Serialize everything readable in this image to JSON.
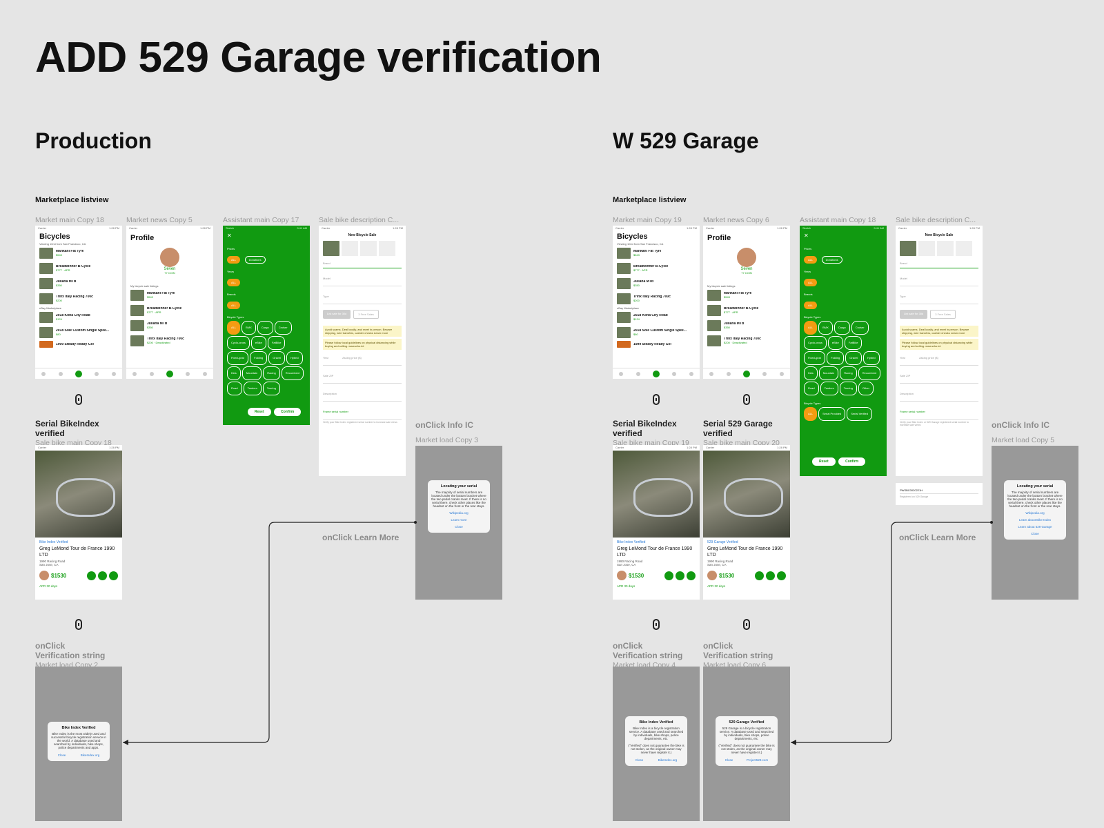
{
  "title": "ADD 529 Garage verification",
  "columns": {
    "production": "Production",
    "garage": "W 529 Garage"
  },
  "section_label": "Marketplace listview",
  "frame_labels": {
    "p_main": "Market main Copy 18",
    "p_news": "Market news Copy 5",
    "p_assist": "Assistant main Copy 17",
    "p_sale": "Sale bike description C...",
    "g_main": "Market main Copy 19",
    "g_news": "Market news Copy 6",
    "g_assist": "Assistant main Copy 18",
    "g_sale": "Sale bike description C..."
  },
  "annotations": {
    "serial_bikeindex": "Serial BikeIndex verified",
    "serial_529": "Serial 529 Garage verified",
    "p_sale_main": "Sale bike main Copy 18",
    "g_sale_main1": "Sale bike main Copy 19",
    "g_sale_main2": "Sale bike main Copy 20",
    "onclick_info": "onClick Info IC",
    "p_load3": "Market load Copy 3",
    "g_load5": "Market load Copy 5",
    "onclick_learn": "onClick Learn More",
    "onclick": "onClick",
    "verification_string": "Verification string",
    "p_load2": "Market load Copy 2",
    "g_load4": "Market load Copy 4",
    "g_load6": "Market load Copy 6"
  },
  "market": {
    "title": "Bicycles",
    "chips": "Viewing 10mi from San Francisco, CA",
    "items": [
      {
        "name": "Mankani Fat Tyre",
        "price": "$543"
      },
      {
        "name": "Breadwinner B-Cycle",
        "price": "$777 · APR"
      },
      {
        "name": "Juliana MTB",
        "price": "$350"
      },
      {
        "name": "Trinx Italy Racing 700c",
        "price": "$200"
      },
      {
        "name": "2018 Kona City Road",
        "price": "$124"
      },
      {
        "name": "2018 Solé Custom Single Spee...",
        "price": "$80"
      },
      {
        "name": "1999 Steady Ready Go!",
        "price": ""
      }
    ],
    "ebay": "eBay Marketplace"
  },
  "profile": {
    "title": "Profile",
    "name": "Seven",
    "coins": "77 COIN",
    "listings_label": "My bicycle sale listings",
    "items": [
      {
        "name": "Mankani Fat Tyre",
        "price": "$543"
      },
      {
        "name": "Breadwinner B-Cycle",
        "price": "$777 · APR"
      },
      {
        "name": "Juliana MTB",
        "price": "$350"
      },
      {
        "name": "Trinx Italy Racing 700c",
        "price": "$200 · Deactivated"
      }
    ]
  },
  "assistant": {
    "prices": "Prices",
    "years": "Years",
    "brands": "Brands",
    "types": "Bicycle Types",
    "all": "ALL",
    "donations": "Donations",
    "type_chips": [
      "BMX",
      "Cargo",
      "Cruiser",
      "Cyclo-cross",
      "eBike",
      "FatBike",
      "Fixed-gear",
      "Folding",
      "Gravel",
      "Hybrid",
      "Kids",
      "Mountain",
      "Racing",
      "Recumbent",
      "Road",
      "Tandem",
      "Touring"
    ],
    "other": "Other",
    "serial_chips": [
      "Serial Provided",
      "Serial Verified"
    ],
    "reset": "Reset",
    "confirm": "Confirm"
  },
  "sale": {
    "title": "New Bicycle Sale",
    "brand": "Brand",
    "model": "Model",
    "type": "Type",
    "list_btn": "List sale for 30d",
    "free": "3 Free Sales",
    "warn1": "Avoid scams. Deal locally, and meet in person. Beware shipping, wire transfers, cashier checks Learn more",
    "warn2": "Please follow local guidelines on physical distancing while buying and selling. www.who.int",
    "year": "Year",
    "asking": "Asking price ($)",
    "zip": "Sale ZIP",
    "desc": "Description",
    "serial": "Frame serial number",
    "serial_note": "Verify your Bike Index registered serial number to increase sale views",
    "serial_note_g": "Verify your Bike Index or 529 Garage registered serial number to increase sale views",
    "serial_value": "PWSBC0020221H",
    "serial_value_note": "Registered on 529 Garage"
  },
  "bike": {
    "verified_bi": "Bike Index Verified",
    "verified_529": "529 Garage Verified",
    "name": "Greg LeMond Tour de France 1990 LTD",
    "sub": "1990 Racing Road",
    "loc": "San Jose, CA",
    "price": "$1530",
    "apr": "APR 30 days"
  },
  "dialog_serial": {
    "title": "Locating your serial",
    "body": "The majority of serial numbers are located under the bottom bracket where the two pedal cranks meet. If there is no serial there, check other places like the headset on the front or the rear stays.",
    "wiki": "Wikipedia.org",
    "learn": "Learn more",
    "learn_bi": "Learn about Bike Index",
    "learn_529": "Learn about 529 Garage",
    "close": "Close"
  },
  "dialog_bi": {
    "title": "Bike Index Verified",
    "body": "Bike Index is the most widely used and successful bicycle registration service in the world. A database used and searched by individuals, bike shops, police departments and apps.",
    "body_g": "Bike Index is a bicycle registration service. A database used and searched by individuals, bike shops, police departments, etc.",
    "note": "(\"Verified\" does not guarantee the bike is not stolen, as the original owner may never have register it.)",
    "close": "Close",
    "link": "BikeIndex.org"
  },
  "dialog_529": {
    "title": "529 Garage Verified",
    "body": "529 Garage is a bicycle registration service. A database used and searched by individuals, bike shops, police departments, etc.",
    "note": "(\"Verified\" does not guarantee the bike is not stolen, as the original owner may never have register it.)",
    "close": "Close",
    "link": "Project529.com"
  }
}
